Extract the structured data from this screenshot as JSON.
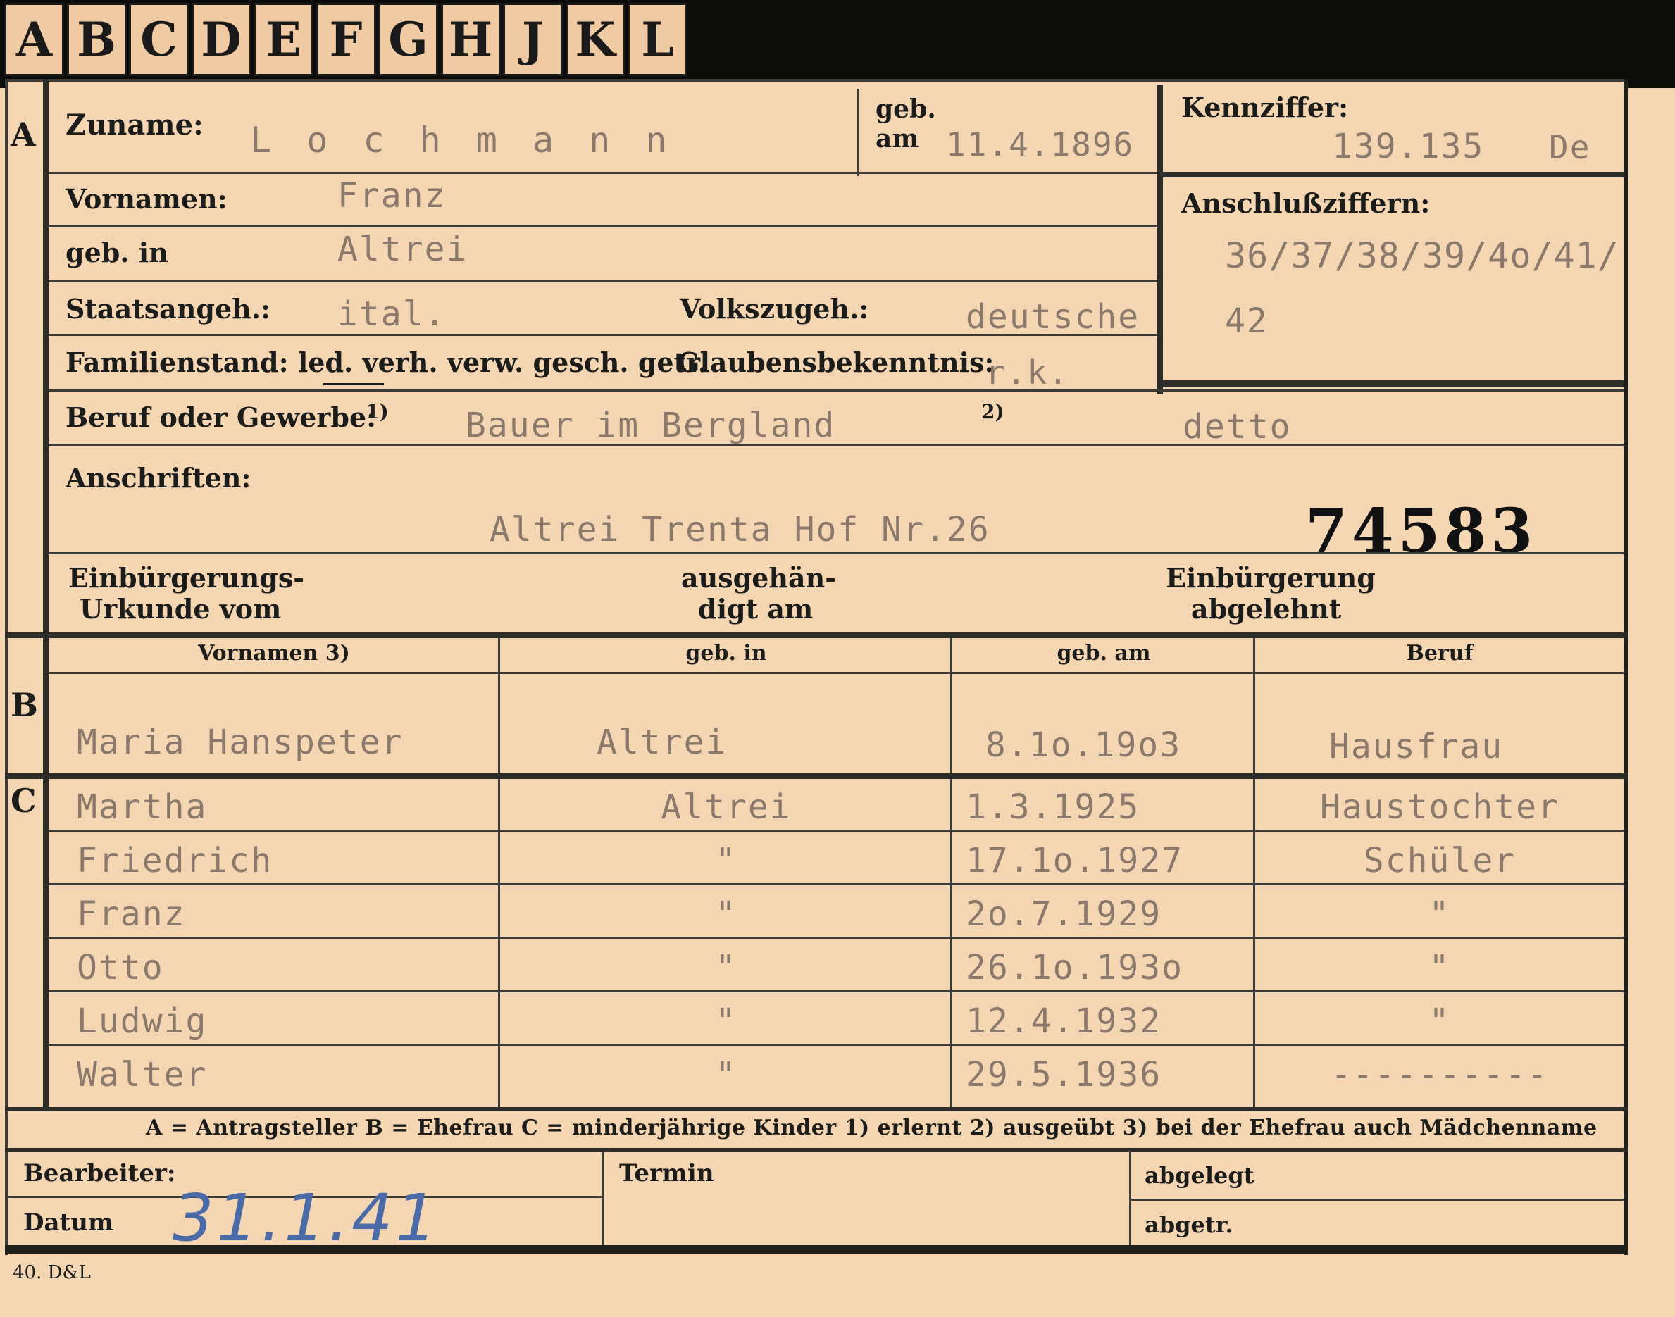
{
  "tabs": [
    "A",
    "B",
    "C",
    "D",
    "E",
    "F",
    "G",
    "H",
    "J",
    "K",
    "L"
  ],
  "section_markers": {
    "a": "A",
    "b": "B",
    "c": "C"
  },
  "applicant": {
    "zuname_label": "Zuname:",
    "zuname": "L o c h m a n n",
    "geb_label": "geb.",
    "am_label": "am",
    "geb_am": "11.4.1896",
    "kennziffer_label": "Kennziffer:",
    "kennziffer": "139.135",
    "kennziffer_suffix": "De",
    "vornamen_label": "Vornamen:",
    "vornamen": "Franz",
    "geb_in_label": "geb. in",
    "geb_in": "Altrei",
    "anschluss_label": "Anschlußziffern:",
    "anschluss_line1": "36/37/38/39/4o/41/",
    "anschluss_line2": "42",
    "staatsangeh_label": "Staatsangeh.:",
    "staatsangeh": "ital.",
    "volkszugeh_label": "Volkszugeh.:",
    "volkszugeh": "deutsche",
    "familienstand_label": "Familienstand: led. verh. verw. gesch. getr.",
    "glaube_label": "Glaubensbekenntnis:",
    "glaube": "r.k.",
    "beruf_label": "Beruf oder Gewerbe:",
    "fn1": "1)",
    "beruf1": "Bauer im Bergland",
    "fn2": "2)",
    "beruf2": "detto",
    "anschriften_label": "Anschriften:",
    "anschrift": "Altrei Trenta Hof Nr.26",
    "stamp_number": "74583",
    "einb_urkunde_label_1": "Einbürgerungs-",
    "einb_urkunde_label_2": "Urkunde vom",
    "ausgehaendigt_1": "ausgehän-",
    "ausgehaendigt_2": "digt am",
    "abgelehnt_1": "Einbürgerung",
    "abgelehnt_2": "abgelehnt"
  },
  "table_headers": {
    "vornamen": "Vornamen 3)",
    "geb_in": "geb. in",
    "geb_am": "geb. am",
    "beruf": "Beruf"
  },
  "spouse": {
    "vornamen": "Maria Hanspeter",
    "geb_in": "Altrei",
    "geb_am": "8.1o.19o3",
    "beruf": "Hausfrau"
  },
  "children": [
    {
      "vornamen": "Martha",
      "geb_in": "Altrei",
      "geb_am": "1.3.1925",
      "beruf": "Haustochter"
    },
    {
      "vornamen": "Friedrich",
      "geb_in": "\"",
      "geb_am": "17.1o.1927",
      "beruf": "Schüler"
    },
    {
      "vornamen": "Franz",
      "geb_in": "\"",
      "geb_am": "2o.7.1929",
      "beruf": "\""
    },
    {
      "vornamen": "Otto",
      "geb_in": "\"",
      "geb_am": "26.1o.193o",
      "beruf": "\""
    },
    {
      "vornamen": "Ludwig",
      "geb_in": "\"",
      "geb_am": "12.4.1932",
      "beruf": "\""
    },
    {
      "vornamen": "Walter",
      "geb_in": "\"",
      "geb_am": "29.5.1936",
      "beruf": "----------"
    }
  ],
  "legend": "A = Antragsteller   B = Ehefrau   C = minderjährige Kinder   1) erlernt   2) ausgeübt   3) bei der Ehefrau auch Mädchenname",
  "footer": {
    "bearbeiter_label": "Bearbeiter:",
    "datum_label": "Datum",
    "datum_value": "31.1.41",
    "termin_label": "Termin",
    "abgelegt_label": "abgelegt",
    "abgetr_label": "abgetr."
  },
  "print_code": "40. D&L",
  "colors": {
    "paper": "#f4d6b3",
    "typed": "#8b7a6c",
    "ink_blue": "#4a6aa8",
    "stamp": "#111111"
  }
}
